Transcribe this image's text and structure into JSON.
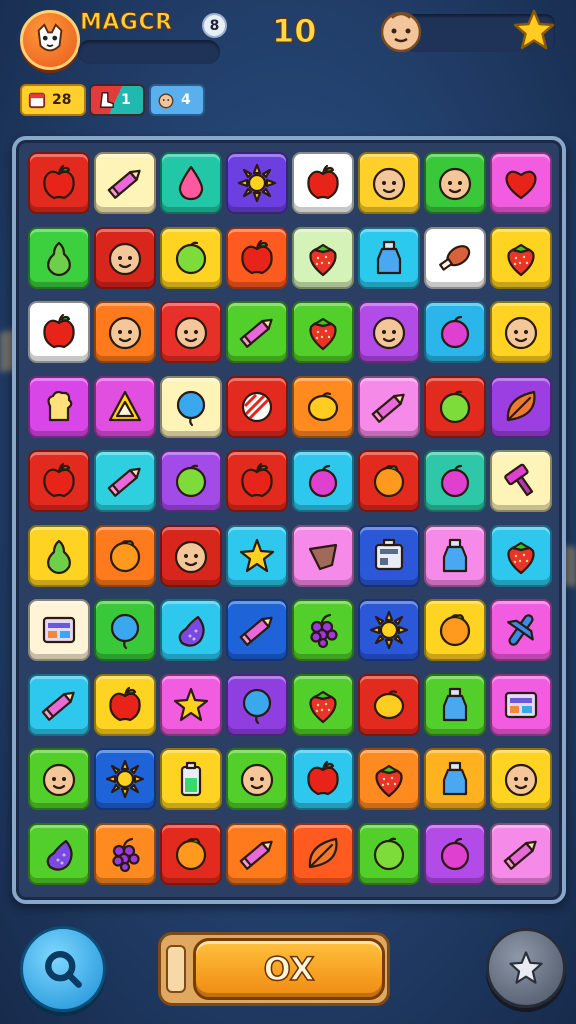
{
  "header": {
    "title": "MAGCR",
    "notification_count": "8",
    "score": "10"
  },
  "stats": [
    {
      "icon": "calendar-icon",
      "value": "28"
    },
    {
      "icon": "boot-icon",
      "value": "1"
    },
    {
      "icon": "baby-face-icon",
      "value": "4"
    }
  ],
  "board": {
    "rows": 10,
    "cols": 8,
    "tiles": [
      {
        "color": "#e22a1e",
        "icon": "apple"
      },
      {
        "color": "#fff4b8",
        "icon": "pencil"
      },
      {
        "color": "#22c7a8",
        "icon": "drop"
      },
      {
        "color": "#6b3fe0",
        "icon": "sun"
      },
      {
        "color": "#ffffff",
        "icon": "apple"
      },
      {
        "color": "#ffd02a",
        "icon": "face"
      },
      {
        "color": "#39c83a",
        "icon": "face"
      },
      {
        "color": "#f25ce0",
        "icon": "heart"
      },
      {
        "color": "#3ccf3e",
        "icon": "pear"
      },
      {
        "color": "#d9261c",
        "icon": "face"
      },
      {
        "color": "#ffd321",
        "icon": "lime"
      },
      {
        "color": "#ff5a1f",
        "icon": "apple"
      },
      {
        "color": "#d5f2b8",
        "icon": "strawberry"
      },
      {
        "color": "#2cc9ee",
        "icon": "bottle"
      },
      {
        "color": "#ffffff",
        "icon": "drumstick"
      },
      {
        "color": "#ffd321",
        "icon": "strawberry"
      },
      {
        "color": "#ffffff",
        "icon": "apple"
      },
      {
        "color": "#ff7a1c",
        "icon": "face"
      },
      {
        "color": "#e8302a",
        "icon": "face"
      },
      {
        "color": "#52cf2a",
        "icon": "pencil"
      },
      {
        "color": "#52cf2a",
        "icon": "strawberry"
      },
      {
        "color": "#b24be8",
        "icon": "face"
      },
      {
        "color": "#2ab6ea",
        "icon": "plum"
      },
      {
        "color": "#ffd321",
        "icon": "face"
      },
      {
        "color": "#d946e8",
        "icon": "chef"
      },
      {
        "color": "#e04fe0",
        "icon": "triangle"
      },
      {
        "color": "#fff4b8",
        "icon": "balloon"
      },
      {
        "color": "#e22a1e",
        "icon": "stripe-ball"
      },
      {
        "color": "#ff8a1f",
        "icon": "lemon"
      },
      {
        "color": "#f58ae8",
        "icon": "pencil"
      },
      {
        "color": "#e22a1e",
        "icon": "lime"
      },
      {
        "color": "#9b3fe0",
        "icon": "leaf"
      },
      {
        "color": "#e22a1e",
        "icon": "apple"
      },
      {
        "color": "#2ed0e0",
        "icon": "pencil"
      },
      {
        "color": "#a24be8",
        "icon": "lime"
      },
      {
        "color": "#e22a1e",
        "icon": "apple"
      },
      {
        "color": "#2ec7ee",
        "icon": "plum"
      },
      {
        "color": "#e22a1e",
        "icon": "orange"
      },
      {
        "color": "#2ec7a8",
        "icon": "plum"
      },
      {
        "color": "#fff4b8",
        "icon": "hammer"
      },
      {
        "color": "#ffd321",
        "icon": "pear"
      },
      {
        "color": "#ff7a1c",
        "icon": "orange"
      },
      {
        "color": "#d9261c",
        "icon": "face"
      },
      {
        "color": "#2ec7ee",
        "icon": "star"
      },
      {
        "color": "#f58ae8",
        "icon": "diamond"
      },
      {
        "color": "#2a58d8",
        "icon": "radio"
      },
      {
        "color": "#f58ae8",
        "icon": "bottle"
      },
      {
        "color": "#2ec7ee",
        "icon": "strawberry"
      },
      {
        "color": "#fff4d8",
        "icon": "window"
      },
      {
        "color": "#39c83a",
        "icon": "balloon"
      },
      {
        "color": "#2ec7ee",
        "icon": "eggplant"
      },
      {
        "color": "#1e63d8",
        "icon": "pencil"
      },
      {
        "color": "#52cf2a",
        "icon": "grapes"
      },
      {
        "color": "#2a58d8",
        "icon": "sun"
      },
      {
        "color": "#ffd321",
        "icon": "orange"
      },
      {
        "color": "#f25ce0",
        "icon": "plane"
      },
      {
        "color": "#2ec7ee",
        "icon": "pencil"
      },
      {
        "color": "#ffd321",
        "icon": "apple"
      },
      {
        "color": "#f25ce0",
        "icon": "star"
      },
      {
        "color": "#8f3fe0",
        "icon": "balloon"
      },
      {
        "color": "#52cf2a",
        "icon": "strawberry"
      },
      {
        "color": "#e22a1e",
        "icon": "lemon"
      },
      {
        "color": "#52cf2a",
        "icon": "bottle"
      },
      {
        "color": "#f25ce0",
        "icon": "window"
      },
      {
        "color": "#52cf2a",
        "icon": "face"
      },
      {
        "color": "#1e63d8",
        "icon": "sun"
      },
      {
        "color": "#ffd321",
        "icon": "battery"
      },
      {
        "color": "#52cf2a",
        "icon": "face"
      },
      {
        "color": "#2ec7ee",
        "icon": "apple"
      },
      {
        "color": "#ff8a1f",
        "icon": "strawberry"
      },
      {
        "color": "#ffb21f",
        "icon": "bottle"
      },
      {
        "color": "#ffd321",
        "icon": "face"
      },
      {
        "color": "#52cf2a",
        "icon": "eggplant"
      },
      {
        "color": "#ff8a1f",
        "icon": "grapes"
      },
      {
        "color": "#e22a1e",
        "icon": "orange"
      },
      {
        "color": "#ff7a1c",
        "icon": "pencil"
      },
      {
        "color": "#ff5a1f",
        "icon": "leaf"
      },
      {
        "color": "#52cf2a",
        "icon": "lime"
      },
      {
        "color": "#b24be8",
        "icon": "plum"
      },
      {
        "color": "#f58ae8",
        "icon": "pencil"
      }
    ]
  },
  "bottom": {
    "confirm_label": "OX",
    "left_icon": "magnifier-icon",
    "right_icon": "star-icon"
  },
  "colors": {
    "background": "#223f6b",
    "board_frame": "#8aa6c9",
    "accent": "#ffcf3a"
  }
}
